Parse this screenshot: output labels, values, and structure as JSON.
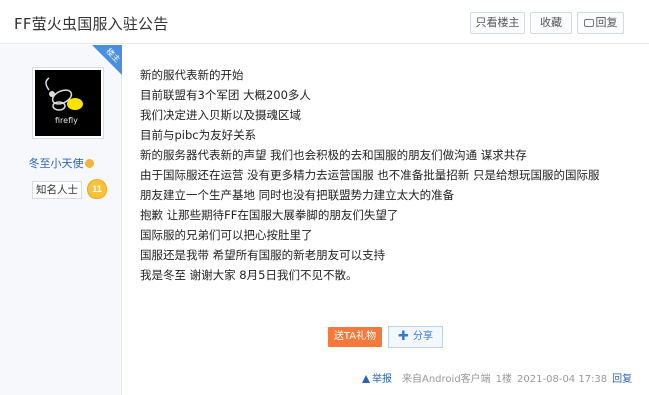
{
  "header": {
    "title": "FF萤火虫国服入驻公告",
    "only_op": "只看楼主",
    "favorite": "收藏",
    "reply": "回复"
  },
  "author": {
    "avatar_text": "firefly",
    "username": "冬至小天使",
    "level_title": "知名人士",
    "level": "11",
    "op_badge": "楼主"
  },
  "post": {
    "lines": [
      "新的服代表新的开始",
      "目前联盟有3个军团 大概200多人",
      "我们决定进入贝斯以及摄魂区域",
      "目前与pibc为友好关系",
      "新的服务器代表新的声望 我们也会积极的去和国服的朋友们做沟通 谋求共存",
      "由于国际服还在运营 没有更多精力去运营国服 也不准备批量招新 只是给想玩国服的国际服",
      "朋友建立一个生产基地 同时也没有把联盟势力建立太大的准备",
      "抱歉 让那些期待FF在国服大展拳脚的朋友们失望了",
      "国际服的兄弟们可以把心按肚里了",
      "国服还是我带 希望所有国服的新老朋友可以支持",
      "我是冬至 谢谢大家 8月5日我们不见不散。"
    ],
    "gift_button": "送TA礼物",
    "share_button": "分享"
  },
  "footer": {
    "report": "举报",
    "client": "来自Android客户端",
    "floor": "1楼",
    "time": "2021-08-04 17:38",
    "reply": "回复"
  },
  "colors": {
    "link": "#2d64b3",
    "op_badge": "#4a8ede",
    "gift": "#f5793a",
    "level_badge": "#f7c33b"
  }
}
